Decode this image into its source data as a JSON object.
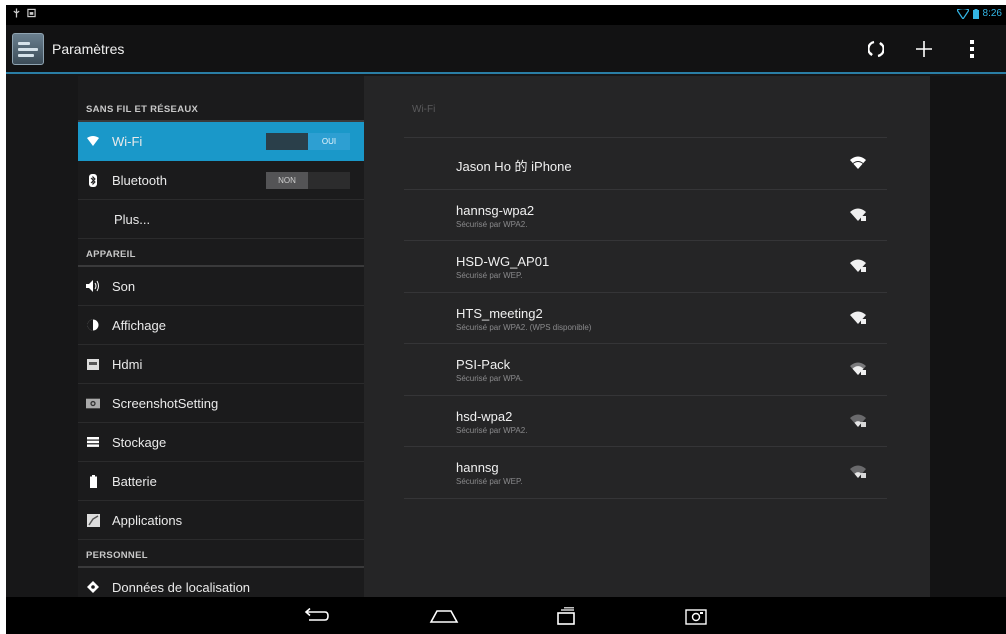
{
  "statusbar": {
    "time": "8:26"
  },
  "actionbar": {
    "title": "Paramètres"
  },
  "settings": {
    "sections": [
      {
        "header": "SANS FIL ET RÉSEAUX",
        "items": [
          {
            "label": "Wi-Fi",
            "icon": "wifi-icon",
            "toggle": "OUI",
            "selected": true
          },
          {
            "label": "Bluetooth",
            "icon": "bluetooth-icon",
            "toggle": "NON"
          },
          {
            "label": "Plus..."
          }
        ]
      },
      {
        "header": "APPAREIL",
        "items": [
          {
            "label": "Son",
            "icon": "speaker-icon"
          },
          {
            "label": "Affichage",
            "icon": "brightness-icon"
          },
          {
            "label": "Hdmi",
            "icon": "hdmi-icon"
          },
          {
            "label": "ScreenshotSetting",
            "icon": "camera-icon"
          },
          {
            "label": "Stockage",
            "icon": "storage-icon"
          },
          {
            "label": "Batterie",
            "icon": "battery-icon"
          },
          {
            "label": "Applications",
            "icon": "apps-icon"
          }
        ]
      },
      {
        "header": "PERSONNEL",
        "items": [
          {
            "label": "Données de localisation",
            "icon": "location-icon"
          }
        ]
      }
    ]
  },
  "wifi": {
    "title": "Wi-Fi",
    "networks": [
      {
        "name": "Jason Ho 的 iPhone",
        "security": "",
        "signal": 4
      },
      {
        "name": "hannsg-wpa2",
        "security": "Sécurisé par WPA2.",
        "signal": 4
      },
      {
        "name": "HSD-WG_AP01",
        "security": "Sécurisé par WEP.",
        "signal": 4
      },
      {
        "name": "HTS_meeting2",
        "security": "Sécurisé par WPA2. (WPS disponible)",
        "signal": 4
      },
      {
        "name": "PSI-Pack",
        "security": "Sécurisé par WPA.",
        "signal": 3
      },
      {
        "name": "hsd-wpa2",
        "security": "Sécurisé par WPA2.",
        "signal": 2
      },
      {
        "name": "hannsg",
        "security": "Sécurisé par WEP.",
        "signal": 2
      }
    ]
  },
  "colors": {
    "accent": "#1a98c9",
    "background": "#171718"
  }
}
